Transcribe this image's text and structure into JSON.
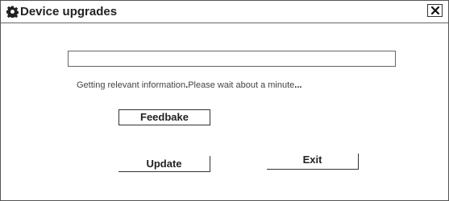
{
  "window": {
    "title": "Device upgrades",
    "title_icon": "gear-icon",
    "close_icon": "close-icon"
  },
  "progress": {
    "value": 0
  },
  "status": {
    "message": "Getting relevant information",
    "separator": ".",
    "wait_text": "Please wait about a minute",
    "ellipsis": "..."
  },
  "buttons": {
    "feedback_label": "Feedbake",
    "update_label": "Update",
    "exit_label": "Exit"
  }
}
